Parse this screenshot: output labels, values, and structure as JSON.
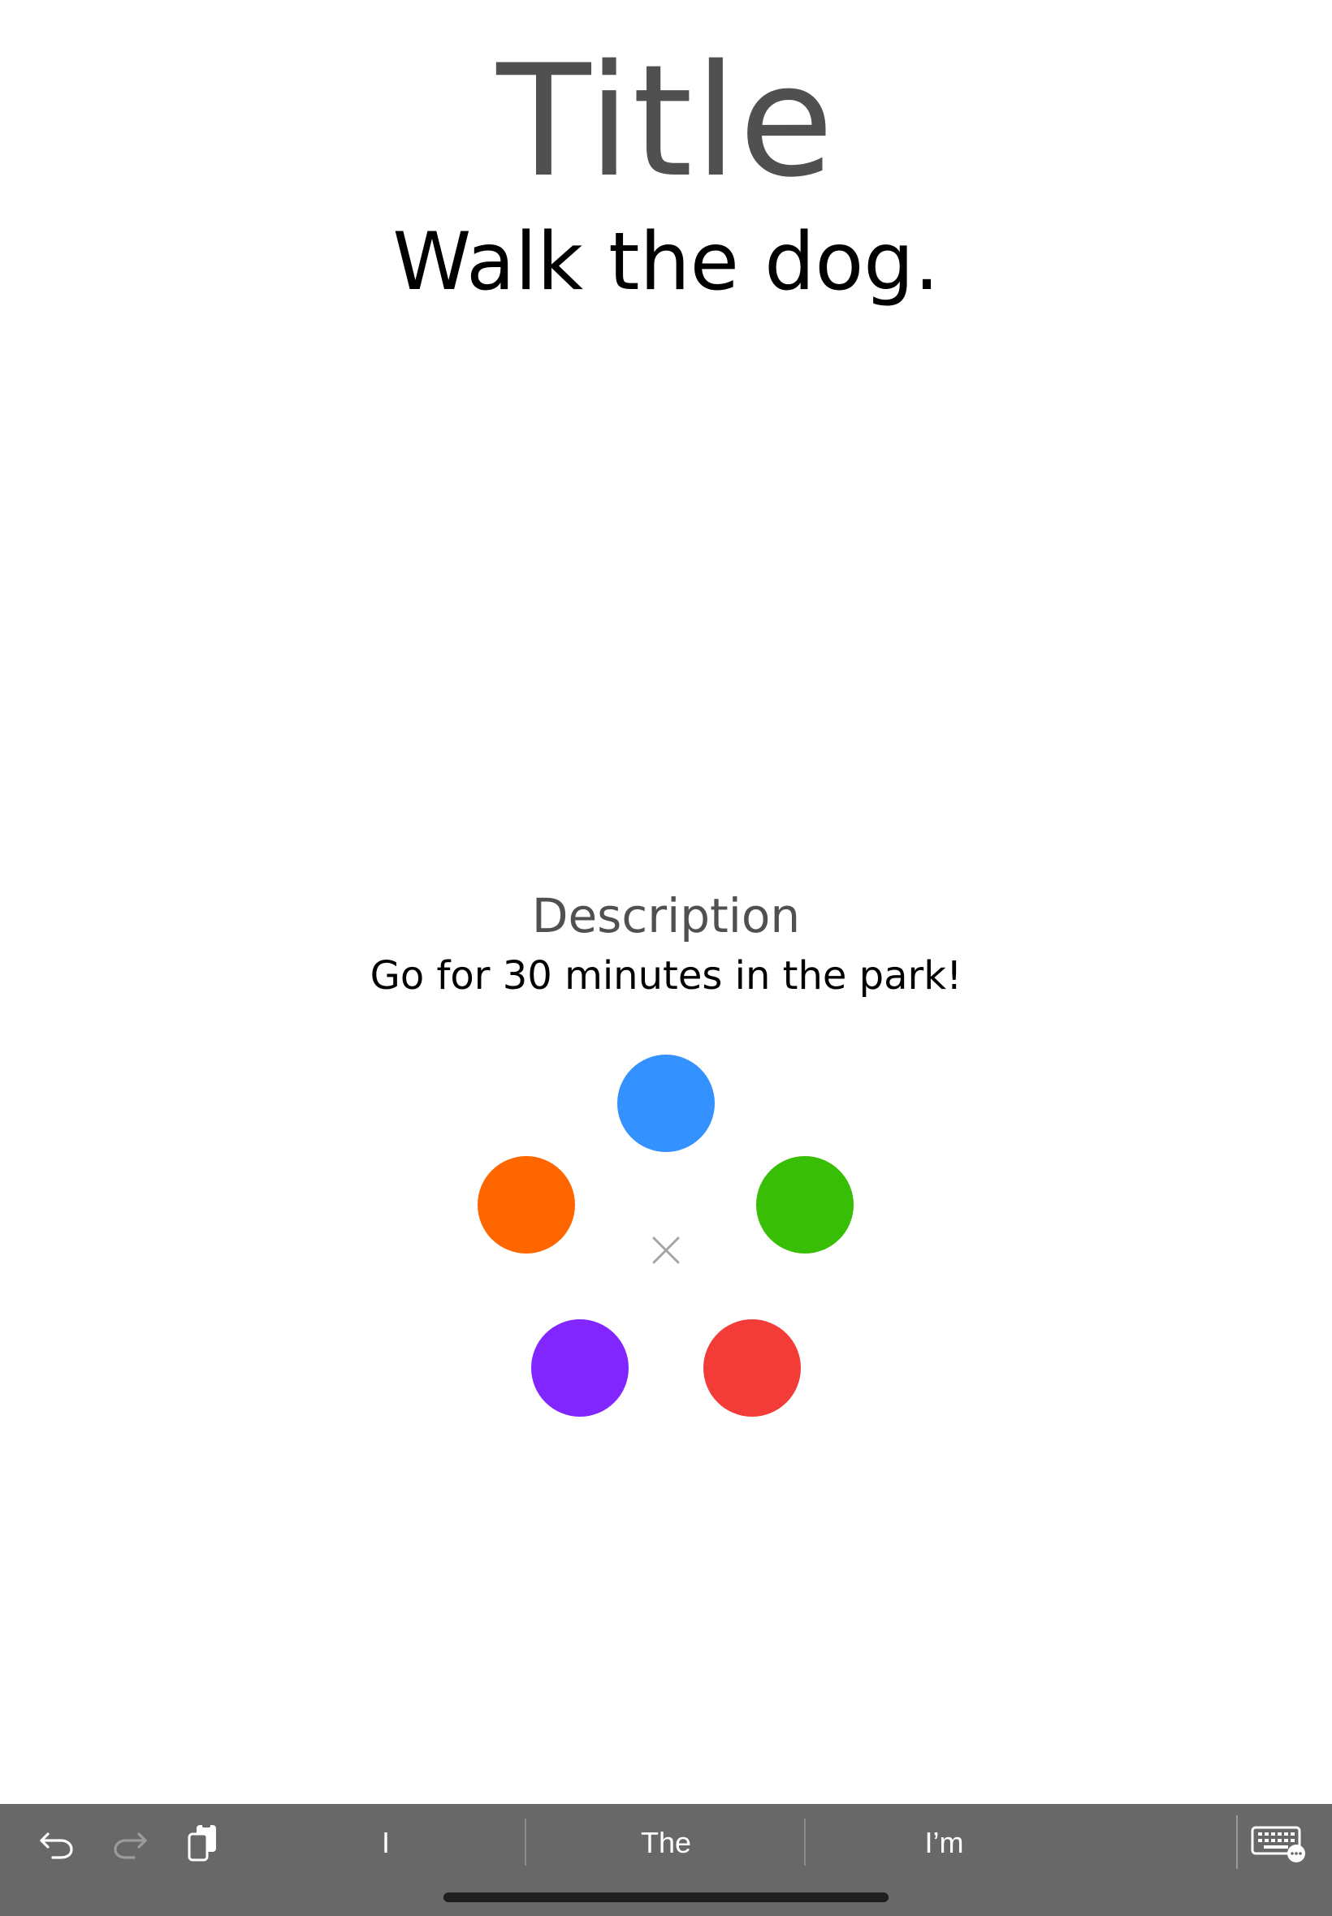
{
  "task": {
    "title_label": "Title",
    "title_value": "Walk the dog.",
    "description_label": "Description",
    "description_value": "Go for 30 minutes in the park!"
  },
  "color_picker": {
    "options": [
      {
        "name": "blue",
        "hex": "#3392FF"
      },
      {
        "name": "orange",
        "hex": "#FF6600"
      },
      {
        "name": "green",
        "hex": "#38BE05"
      },
      {
        "name": "purple",
        "hex": "#8126FF"
      },
      {
        "name": "red",
        "hex": "#F33B37"
      }
    ],
    "close_icon": "close-icon"
  },
  "keyboard_bar": {
    "background": "#686868",
    "icons": {
      "undo": "undo-icon",
      "redo": "redo-icon",
      "paste": "paste-icon",
      "keyboard": "keyboard-icon"
    },
    "suggestions": [
      "I",
      "The",
      "I’m"
    ]
  }
}
